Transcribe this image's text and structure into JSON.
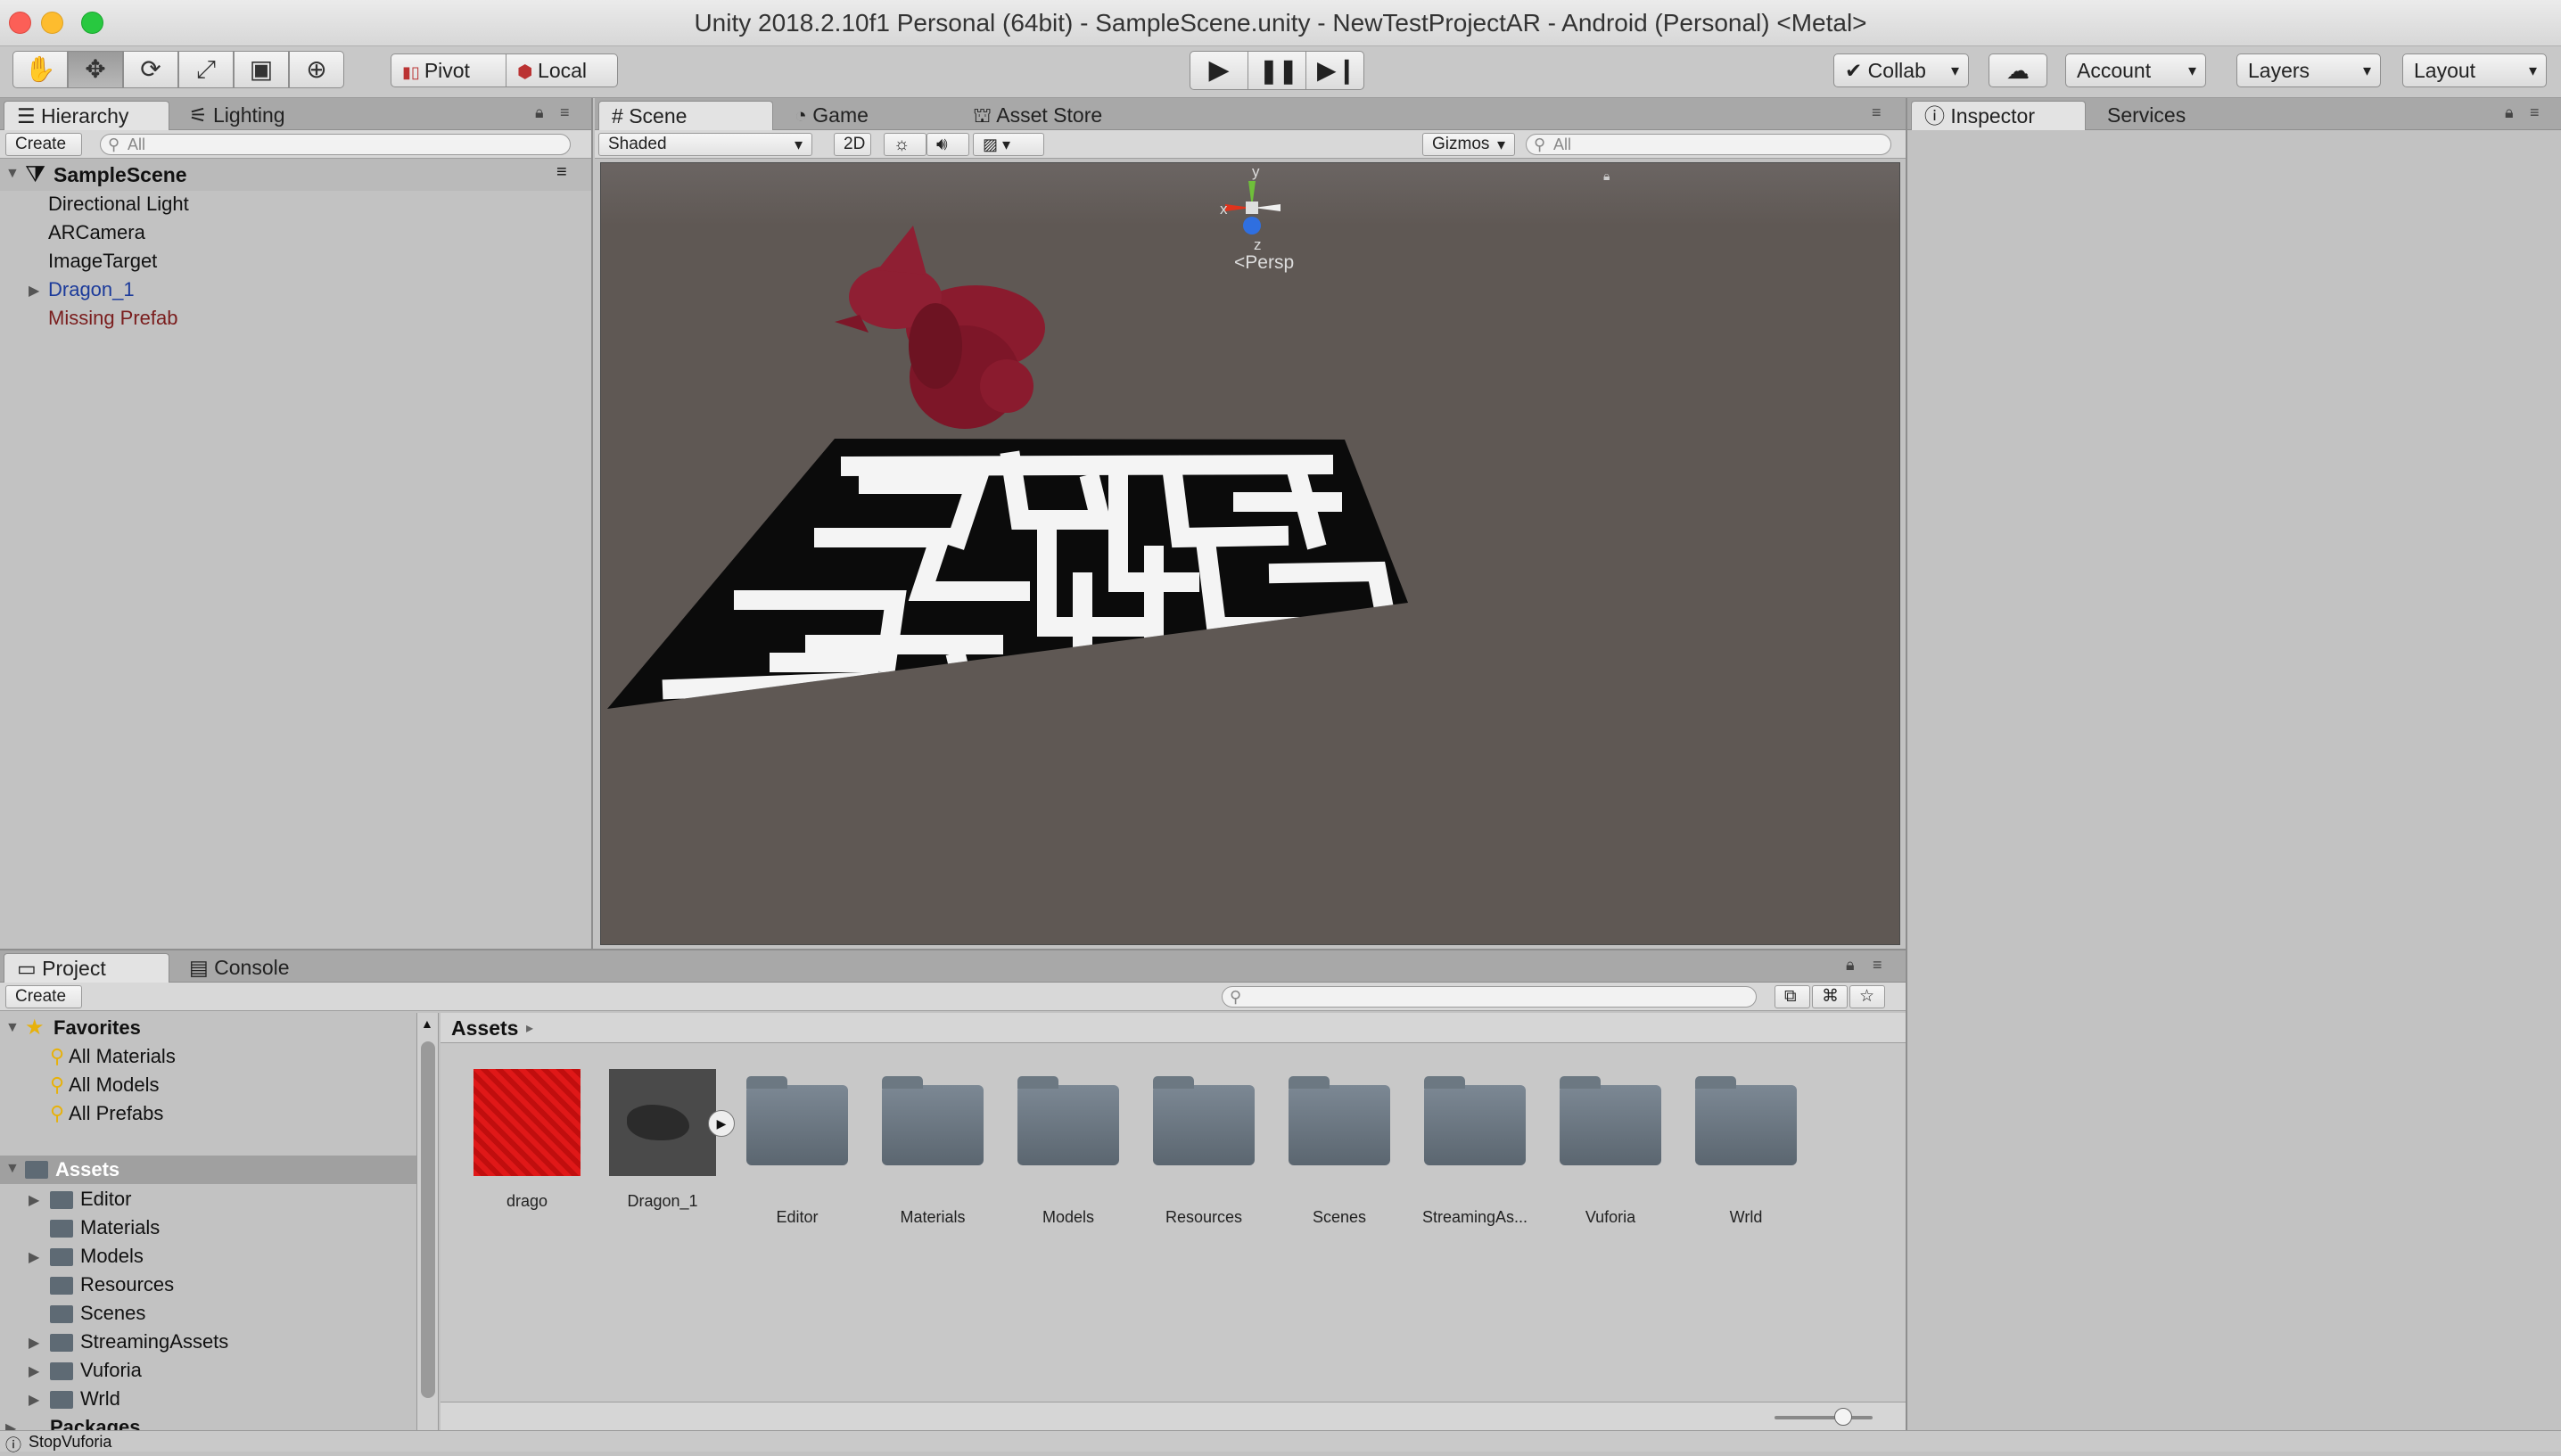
{
  "window": {
    "title": "Unity 2018.2.10f1 Personal (64bit) - SampleScene.unity - NewTestProjectAR - Android (Personal) <Metal>"
  },
  "toolbar": {
    "pivot": "Pivot",
    "local": "Local",
    "collab": "Collab",
    "account": "Account",
    "layers": "Layers",
    "layout": "Layout"
  },
  "hierarchy": {
    "tabs": [
      "Hierarchy",
      "Lighting"
    ],
    "create": "Create",
    "search_placeholder": "All",
    "scene": "SampleScene",
    "items": [
      "Directional Light",
      "ARCamera",
      "ImageTarget",
      "Dragon_1",
      "Missing Prefab"
    ]
  },
  "scene": {
    "tabs": [
      "Scene",
      "Game",
      "Asset Store"
    ],
    "shading": "Shaded",
    "mode2d": "2D",
    "gizmos": "Gizmos",
    "search_placeholder": "All",
    "gizmo": {
      "y": "y",
      "x": "x",
      "z": "z",
      "persp": "Persp"
    }
  },
  "inspector": {
    "tabs": [
      "Inspector",
      "Services"
    ]
  },
  "project": {
    "tabs": [
      "Project",
      "Console"
    ],
    "create": "Create",
    "favorites_label": "Favorites",
    "favorites": [
      "All Materials",
      "All Models",
      "All Prefabs"
    ],
    "assets_label": "Assets",
    "folders": [
      "Editor",
      "Materials",
      "Models",
      "Resources",
      "Scenes",
      "StreamingAssets",
      "Vuforia",
      "Wrld"
    ],
    "packages_label": "Packages",
    "breadcrumb": "Assets",
    "grid": [
      "drago",
      "Dragon_1",
      "Editor",
      "Materials",
      "Models",
      "Resources",
      "Scenes",
      "StreamingAs...",
      "Vuforia",
      "Wrld"
    ],
    "zoom_level": 0.7
  },
  "status": {
    "text": "StopVuforia"
  },
  "colors": {
    "accent_selection": "#a0a0a0",
    "prefab_blue": "#1b3a9a",
    "missing_red": "#7a1d1d",
    "scene_bg": "#5f5854"
  }
}
